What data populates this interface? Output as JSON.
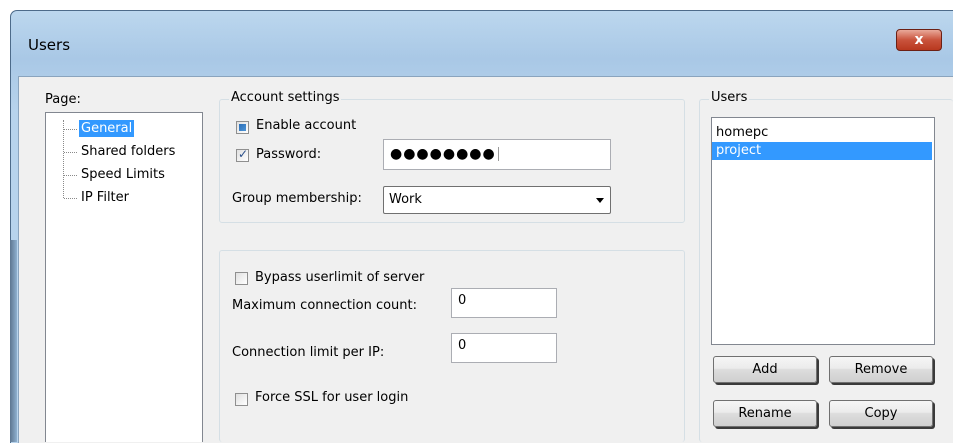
{
  "window": {
    "title": "Users",
    "close_glyph": "x"
  },
  "page_panel": {
    "label": "Page:",
    "items": [
      {
        "label": "General",
        "selected": true
      },
      {
        "label": "Shared folders",
        "selected": false
      },
      {
        "label": "Speed Limits",
        "selected": false
      },
      {
        "label": "IP Filter",
        "selected": false
      }
    ]
  },
  "account_settings": {
    "title": "Account settings",
    "enable_account": {
      "label": "Enable account",
      "state": "indeterminate"
    },
    "password": {
      "label": "Password:",
      "checked": true,
      "value": "●●●●●●●●"
    },
    "group_membership": {
      "label": "Group membership:",
      "value": "Work"
    }
  },
  "connection_settings": {
    "bypass_userlimit": {
      "label": "Bypass userlimit of server",
      "checked": false
    },
    "max_connection_count": {
      "label": "Maximum connection count:",
      "value": "0"
    },
    "connection_limit_per_ip": {
      "label": "Connection limit per IP:",
      "value": "0"
    },
    "force_ssl": {
      "label": "Force SSL for user login",
      "checked": false
    }
  },
  "users_panel": {
    "title": "Users",
    "users": [
      {
        "name": "homepc",
        "selected": false
      },
      {
        "name": "project",
        "selected": true
      }
    ],
    "buttons": {
      "add": "Add",
      "remove": "Remove",
      "rename": "Rename",
      "copy": "Copy"
    }
  },
  "colors": {
    "selection": "#3399ff",
    "window_frame": "#a9c8e6",
    "close_button": "#c9533c"
  }
}
